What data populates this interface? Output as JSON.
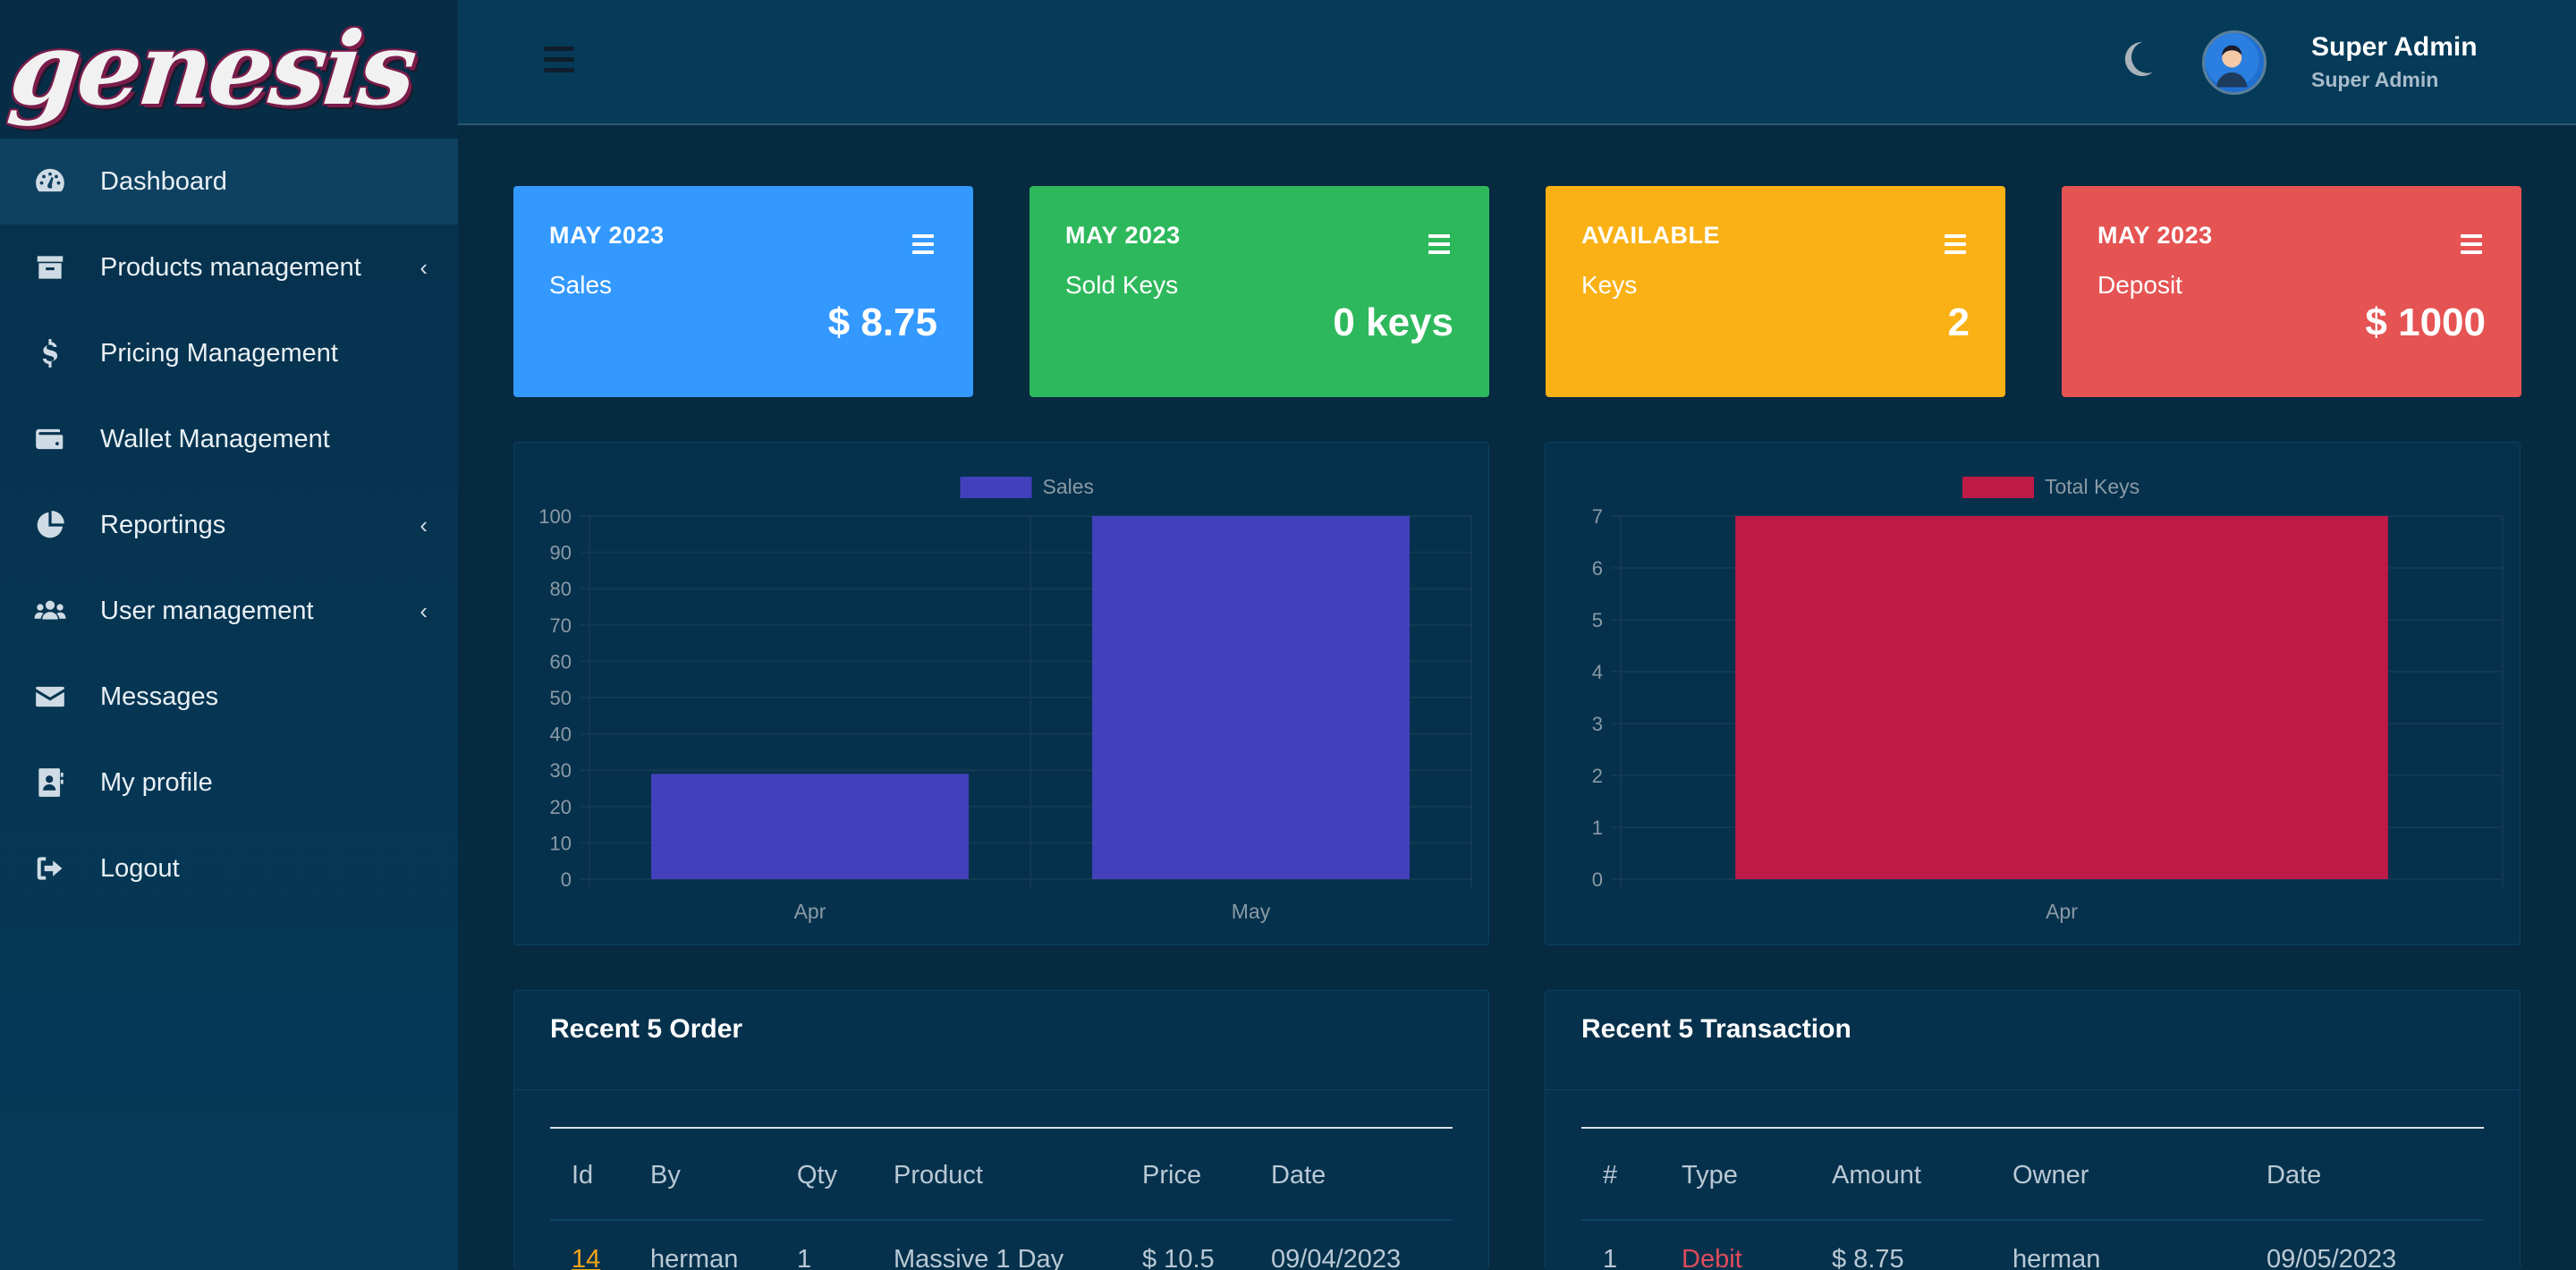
{
  "brand": {
    "logo_text": "genesis"
  },
  "sidebar": {
    "items": [
      {
        "label": "Dashboard",
        "icon": "dashboard-icon",
        "active": true,
        "has_children": false
      },
      {
        "label": "Products management",
        "icon": "archive-icon",
        "active": false,
        "has_children": true
      },
      {
        "label": "Pricing Management",
        "icon": "dollar-icon",
        "active": false,
        "has_children": false
      },
      {
        "label": "Wallet Management",
        "icon": "wallet-icon",
        "active": false,
        "has_children": false
      },
      {
        "label": "Reportings",
        "icon": "pie-chart-icon",
        "active": false,
        "has_children": true
      },
      {
        "label": "User management",
        "icon": "users-icon",
        "active": false,
        "has_children": true
      },
      {
        "label": "Messages",
        "icon": "envelope-icon",
        "active": false,
        "has_children": false
      },
      {
        "label": "My profile",
        "icon": "profile-icon",
        "active": false,
        "has_children": false
      },
      {
        "label": "Logout",
        "icon": "logout-icon",
        "active": false,
        "has_children": false
      }
    ],
    "chevron": "‹"
  },
  "header": {
    "user_name": "Super Admin",
    "user_role": "Super Admin"
  },
  "cards": [
    {
      "top": "MAY 2023",
      "sub": "Sales",
      "value": "$ 8.75",
      "color": "#3399ff"
    },
    {
      "top": "MAY 2023",
      "sub": "Sold Keys",
      "value": "0 keys",
      "color": "#2eb85c"
    },
    {
      "top": "AVAILABLE",
      "sub": "Keys",
      "value": "2",
      "color": "#f9b115"
    },
    {
      "top": "MAY 2023",
      "sub": "Deposit",
      "value": "$ 1000",
      "color": "#e55353"
    }
  ],
  "chart_data": [
    {
      "type": "bar",
      "categories": [
        "Apr",
        "May"
      ],
      "series": [
        {
          "name": "Sales",
          "values": [
            29,
            100
          ],
          "color": "#4340bc"
        }
      ],
      "ylim": [
        0,
        100
      ],
      "yticks": [
        0,
        10,
        20,
        30,
        40,
        50,
        60,
        70,
        80,
        90,
        100
      ],
      "legend": "top-center",
      "grid": true
    },
    {
      "type": "bar",
      "categories": [
        "Apr"
      ],
      "series": [
        {
          "name": "Total Keys",
          "values": [
            7
          ],
          "color": "#be1a47"
        }
      ],
      "ylim": [
        0,
        7
      ],
      "yticks": [
        0,
        1,
        2,
        3,
        4,
        5,
        6,
        7
      ],
      "legend": "top-center",
      "grid": true
    }
  ],
  "orders": {
    "title": "Recent 5 Order",
    "columns": [
      "Id",
      "By",
      "Qty",
      "Product",
      "Price",
      "Date"
    ],
    "rows": [
      [
        "14",
        "herman",
        "1",
        "Massive 1 Day",
        "$ 10.5",
        "09/04/2023"
      ]
    ]
  },
  "transactions": {
    "title": "Recent 5 Transaction",
    "columns": [
      "#",
      "Type",
      "Amount",
      "Owner",
      "Date"
    ],
    "rows": [
      [
        "1",
        "Debit",
        "$ 8.75",
        "herman",
        "09/05/2023"
      ]
    ]
  },
  "colors": {
    "sidebar_bg": "#053a58",
    "page_bg": "#062a40",
    "link": "#f2a51a",
    "debit": "#e04b5b"
  }
}
